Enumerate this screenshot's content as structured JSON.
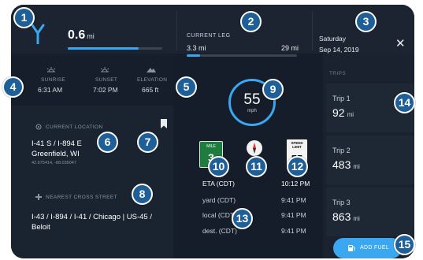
{
  "colors": {
    "background": "#141d29",
    "accent": "#3aa7f0",
    "badge": "#1f5f98",
    "mile_sign": "#1e7c3f"
  },
  "header": {
    "route_icon": "route-fork-icon",
    "distance_value": "0.6",
    "distance_unit": "mi",
    "distance_progress": 0.75,
    "current_leg_title": "CURRENT LEG",
    "leg_start": "3.3 mi",
    "leg_end": "29 mi",
    "leg_progress": 0.12,
    "day": "Saturday",
    "date": "Sep 14, 2019",
    "close_icon": "close-icon"
  },
  "sun": {
    "sunrise_label": "SUNRISE",
    "sunrise_value": "6:31 AM",
    "sunset_label": "SUNSET",
    "sunset_value": "7:02 PM",
    "elevation_label": "ELEVATION",
    "elevation_value": "665 ft"
  },
  "location": {
    "header": "CURRENT LOCATION",
    "road": "I-41 S / I-894 E",
    "city": "Greenfield, WI",
    "coords": "42.975414, -88.039047",
    "bookmark_icon": "bookmark-icon"
  },
  "cross_street": {
    "header": "NEAREST CROSS STREET",
    "line1": "I-43 / I-894 / I-41 / Chicago | US-45 /",
    "line2": "Beloit"
  },
  "speed": {
    "value": "55",
    "unit": "mph"
  },
  "signs": {
    "mile_label": "MILE",
    "mile_value": "3",
    "limit_label": "SPEED LIMIT",
    "limit_value": "55",
    "compass_icon": "compass-icon"
  },
  "eta": {
    "rows": [
      {
        "label": "ETA (CDT)",
        "value": "10:12 PM"
      },
      {
        "label": "yard (CDT)",
        "value": "9:41 PM"
      },
      {
        "label": "local (CDT)",
        "value": "9:41 PM"
      },
      {
        "label": "dest. (CDT)",
        "value": "9:41 PM"
      }
    ]
  },
  "trips": {
    "header": "TRIPS",
    "items": [
      {
        "name": "Trip 1",
        "value": "92",
        "unit": "mi"
      },
      {
        "name": "Trip 2",
        "value": "483",
        "unit": "mi"
      },
      {
        "name": "Trip 3",
        "value": "863",
        "unit": "mi"
      }
    ]
  },
  "add_fuel": {
    "label": "ADD FUEL",
    "icon": "fuel-pump-icon"
  },
  "callouts": [
    "1",
    "2",
    "3",
    "4",
    "5",
    "6",
    "7",
    "8",
    "9",
    "10",
    "11",
    "12",
    "13",
    "14",
    "15"
  ]
}
